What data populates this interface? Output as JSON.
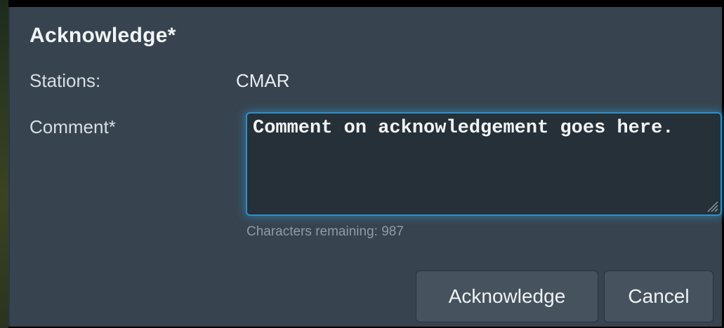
{
  "dialog": {
    "title": "Acknowledge*",
    "stations_label": "Stations:",
    "stations_value": "CMAR",
    "comment_label": "Comment*",
    "comment_value": "Comment on acknowledgement goes here.",
    "characters_remaining": "Characters remaining: 987",
    "acknowledge_label": "Acknowledge",
    "cancel_label": "Cancel"
  },
  "colors": {
    "background": "#37444f",
    "focus_border": "#2f8fc9",
    "button": "#46535e"
  }
}
